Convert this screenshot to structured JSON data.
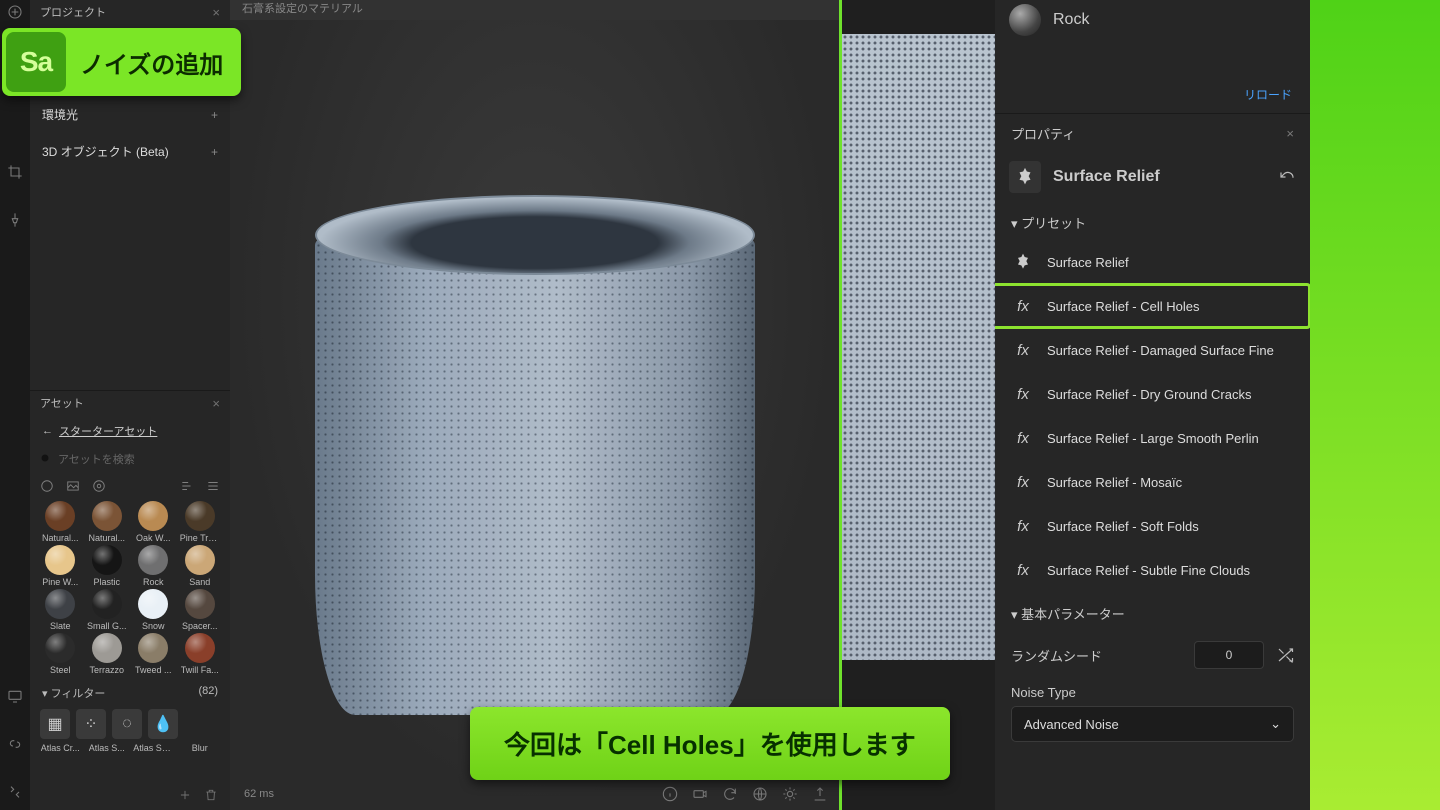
{
  "overlay": {
    "app_badge": "Sa",
    "title": "ノイズの追加",
    "caption": "今回は「Cell Holes」を使用します"
  },
  "project_panel": {
    "title": "プロジェクト",
    "items": [
      {
        "label": "環境光"
      },
      {
        "label": "3D オブジェクト (Beta)"
      }
    ]
  },
  "viewport": {
    "tab": "石膏系設定のマテリアル",
    "status": "62 ms"
  },
  "assets": {
    "title": "アセット",
    "back": "スターターアセット",
    "search_placeholder": "アセットを検索",
    "swatches": [
      {
        "label": "Natural...",
        "color": "#6a3f25"
      },
      {
        "label": "Natural...",
        "color": "#7b5436"
      },
      {
        "label": "Oak W...",
        "color": "#b98a52"
      },
      {
        "label": "Pine Tre...",
        "color": "#4a3a28"
      },
      {
        "label": "Pine W...",
        "color": "#e7c68b"
      },
      {
        "label": "Plastic",
        "color": "#151515"
      },
      {
        "label": "Rock",
        "color": "#6f6f70"
      },
      {
        "label": "Sand",
        "color": "#cba777"
      },
      {
        "label": "Slate",
        "color": "#3e4146"
      },
      {
        "label": "Small G...",
        "color": "#222"
      },
      {
        "label": "Snow",
        "color": "#e9f0f6"
      },
      {
        "label": "Spacer...",
        "color": "#55483f"
      },
      {
        "label": "Steel",
        "color": "#2b2b2b"
      },
      {
        "label": "Terrazzo",
        "color": "#9d9a95"
      },
      {
        "label": "Tweed ...",
        "color": "#8a7d68"
      },
      {
        "label": "Twill Fa...",
        "color": "#8a3f2a"
      }
    ],
    "filters_title": "フィルター",
    "filters_count": "(82)",
    "filters": [
      {
        "label": "Atlas Cr..."
      },
      {
        "label": "Atlas S..."
      },
      {
        "label": "Atlas Sp..."
      },
      {
        "label": "Blur"
      }
    ]
  },
  "layers": {
    "top": {
      "label": "Rock"
    },
    "reload": "リロード"
  },
  "properties": {
    "title": "プロパティ",
    "effect": "Surface Relief",
    "presets_title": "プリセット",
    "presets": [
      {
        "label": "Surface Relief",
        "icon": "relief"
      },
      {
        "label": "Surface Relief - Cell Holes",
        "icon": "fx",
        "highlight": true
      },
      {
        "label": "Surface Relief - Damaged Surface Fine",
        "icon": "fx"
      },
      {
        "label": "Surface Relief - Dry Ground Cracks",
        "icon": "fx"
      },
      {
        "label": "Surface Relief - Large Smooth Perlin",
        "icon": "fx"
      },
      {
        "label": "Surface Relief - Mosaïc",
        "icon": "fx"
      },
      {
        "label": "Surface Relief - Soft Folds",
        "icon": "fx"
      },
      {
        "label": "Surface Relief - Subtle Fine Clouds",
        "icon": "fx"
      }
    ],
    "params_title": "基本パラメーター",
    "random_seed_label": "ランダムシード",
    "random_seed_value": "0",
    "noise_type_label": "Noise Type",
    "noise_type_value": "Advanced Noise"
  }
}
